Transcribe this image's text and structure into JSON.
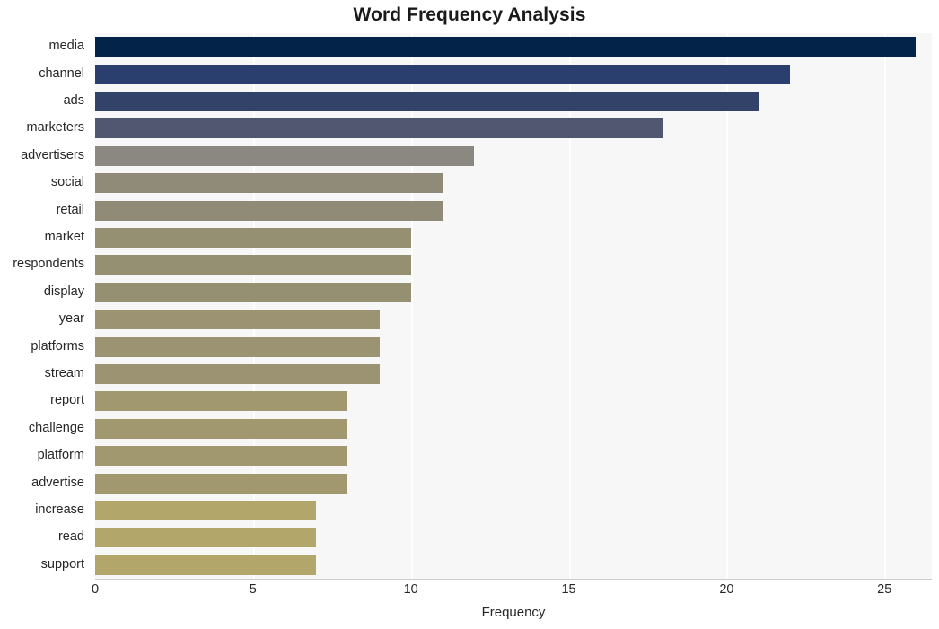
{
  "chart_data": {
    "type": "bar",
    "orientation": "horizontal",
    "title": "Word Frequency Analysis",
    "xlabel": "Frequency",
    "ylabel": "",
    "xlim": [
      0,
      26.5
    ],
    "xticks": [
      0,
      5,
      10,
      15,
      20,
      25
    ],
    "xtick_labels": [
      "0",
      "5",
      "10",
      "15",
      "20",
      "25"
    ],
    "grid": "vertical",
    "legend": "none",
    "plot_background": "#f7f7f7",
    "gridline_color": "#ffffff",
    "figure_background": "#ffffff",
    "categories": [
      "media",
      "channel",
      "ads",
      "marketers",
      "advertisers",
      "social",
      "retail",
      "market",
      "respondents",
      "display",
      "year",
      "platforms",
      "stream",
      "report",
      "challenge",
      "platform",
      "advertise",
      "increase",
      "read",
      "support"
    ],
    "values": [
      26,
      22,
      21,
      18,
      12,
      11,
      11,
      10,
      10,
      10,
      9,
      9,
      9,
      8,
      8,
      8,
      8,
      7,
      7,
      7
    ],
    "bar_colors": [
      "#042349",
      "#2b3f6e",
      "#334268",
      "#525771",
      "#8a8880",
      "#8f8b78",
      "#8f8b76",
      "#969073",
      "#969073",
      "#969073",
      "#9b9372",
      "#9b9372",
      "#9b9372",
      "#a29870",
      "#a29870",
      "#a29870",
      "#a29870",
      "#b3a66b",
      "#b3a66b",
      "#b3a66b"
    ]
  }
}
